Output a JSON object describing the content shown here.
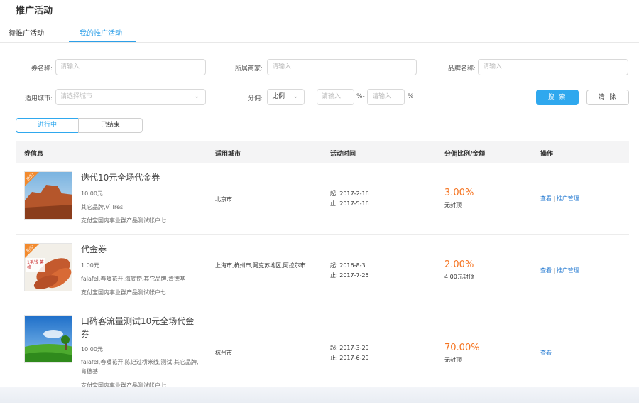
{
  "page": {
    "title": "推广活动"
  },
  "tabs": [
    {
      "label": "待推广活动"
    },
    {
      "label": "我的推广活动"
    }
  ],
  "filters": {
    "coupon_name": {
      "label": "券名称:",
      "placeholder": "请输入"
    },
    "merchant": {
      "label": "所属商家:",
      "placeholder": "请输入"
    },
    "brand": {
      "label": "品牌名称:",
      "placeholder": "请输入"
    },
    "city": {
      "label": "适用城市:",
      "placeholder": "请选择城市"
    },
    "commission": {
      "label": "分佣:",
      "type_value": "比例",
      "min_placeholder": "请输入",
      "range_sep": "%-",
      "max_placeholder": "请输入",
      "unit": "%"
    },
    "search_label": "搜 索",
    "clear_label": "清 除"
  },
  "status_toggle": [
    {
      "label": "进行中"
    },
    {
      "label": "已结束"
    }
  ],
  "table": {
    "headers": [
      "券信息",
      "适用城市",
      "活动时间",
      "分佣比例/金额",
      "操作"
    ],
    "rows": [
      {
        "badge": "折扣",
        "title": "迭代10元全场代金券",
        "amount": "10.00元",
        "brands": "其它品牌,v`Tres",
        "account": "支付宝国内事业群产品测试帐户七",
        "city": "北京市",
        "start": "起: 2017-2-16",
        "end": "止: 2017-5-16",
        "rate": "3.00%",
        "cap": "无封顶",
        "ops": [
          "查看",
          "推广管理"
        ]
      },
      {
        "badge": "折扣",
        "thumb_text": "1毛钱  薯格",
        "title": "代金券",
        "amount": "1.00元",
        "brands": "falafel,春暖花开,海底捞,其它品牌,肯德基",
        "account": "支付宝国内事业群产品测试帐户七",
        "city": "上海市,杭州市,阿克苏地区,阿拉尔市",
        "start": "起: 2016-8-3",
        "end": "止: 2017-7-25",
        "rate": "2.00%",
        "cap": "4.00元封顶",
        "ops": [
          "查看",
          "推广管理"
        ]
      },
      {
        "title": "口碑客流量测试10元全场代金券",
        "amount": "10.00元",
        "brands": "falafel,春暖花开,陈记过桥米线,测试,其它品牌,肯德基",
        "account": "支付宝国内事业群产品测试帐户七",
        "city": "杭州市",
        "start": "起: 2017-3-29",
        "end": "止: 2017-6-29",
        "rate": "70.00%",
        "cap": "无封顶",
        "ops": [
          "查看"
        ]
      }
    ]
  },
  "colors": {
    "accent": "#2fa8ee",
    "rate": "#f5731f",
    "link": "#2d7fd3"
  }
}
